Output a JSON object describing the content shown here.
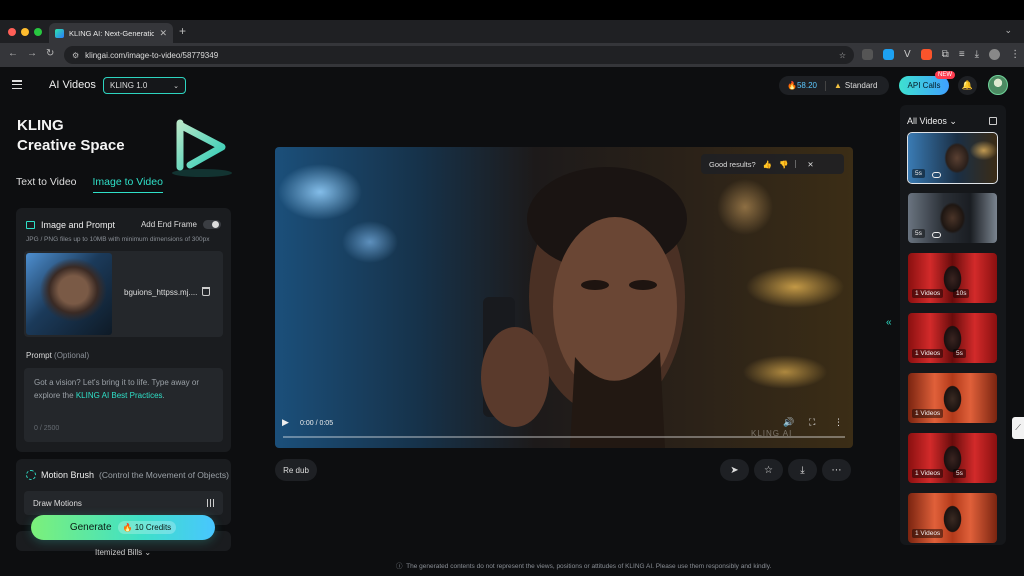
{
  "browser": {
    "tab_title": "KLING AI: Next-Generatio",
    "url": "klingai.com/image-to-video/58779349"
  },
  "header": {
    "app_title": "AI Videos",
    "model": "KLING 1.0",
    "credits": "58.20",
    "plan": "Standard",
    "api_calls": "API Calls",
    "new_badge": "NEW"
  },
  "brand": {
    "line1": "KLING",
    "line2": "Creative Space"
  },
  "mode_tabs": [
    {
      "label": "Text to Video",
      "active": false
    },
    {
      "label": "Image to Video",
      "active": true
    }
  ],
  "image_prompt": {
    "title": "Image and Prompt",
    "end_frame_label": "Add End Frame",
    "hint": "JPG / PNG files up to 10MB with minimum dimensions of 300px",
    "file_name": "bguions_httpss.mj....",
    "prompt_label": "Prompt",
    "prompt_optional": "(Optional)",
    "placeholder_a": "Got a vision? Let's bring it to life. Type away or explore the ",
    "placeholder_link": "KLING AI Best Practices",
    "placeholder_b": ".",
    "counter": "0 / 2500"
  },
  "motion_brush": {
    "title": "Motion Brush",
    "subtitle": "(Control the Movement of Objects)",
    "draw_label": "Draw Motions"
  },
  "generate": {
    "label": "Generate",
    "credits": "10 Credits"
  },
  "itemized_bills": "Itemized Bills",
  "player": {
    "feedback": "Good results?",
    "time": "0:00 / 0:05",
    "progress": 0.0,
    "watermark": "KLING AI"
  },
  "actions": {
    "redub": "Re dub"
  },
  "right_panel": {
    "title": "All Videos",
    "videos": [
      {
        "badge": "5s",
        "duration": "",
        "style": "blue"
      },
      {
        "badge": "5s",
        "duration": "",
        "style": "dark"
      },
      {
        "badge": "1 Videos",
        "duration": "10s",
        "style": "red"
      },
      {
        "badge": "1 Videos",
        "duration": "5s",
        "style": "red"
      },
      {
        "badge": "1 Videos",
        "duration": "",
        "style": "orange"
      },
      {
        "badge": "1 Videos",
        "duration": "5s",
        "style": "red"
      },
      {
        "badge": "1 Videos",
        "duration": "",
        "style": "orange"
      }
    ]
  },
  "disclaimer": "The generated contents do not represent the views, positions or attitudes of KLING AI. Please use them responsibly and kindly.",
  "colors": {
    "accent": "#2fe0c8",
    "panel": "#1a1c1f",
    "background": "#0d0e10"
  },
  "icons": [
    "menu-icon",
    "chevron-down-icon",
    "credit-flame-icon",
    "bell-icon",
    "trash-icon",
    "thumbs-up-icon",
    "thumbs-down-icon",
    "close-icon",
    "play-icon",
    "volume-icon",
    "fullscreen-icon",
    "share-icon",
    "star-icon",
    "download-icon",
    "more-icon",
    "copy-icon",
    "double-chevron-left-icon"
  ]
}
